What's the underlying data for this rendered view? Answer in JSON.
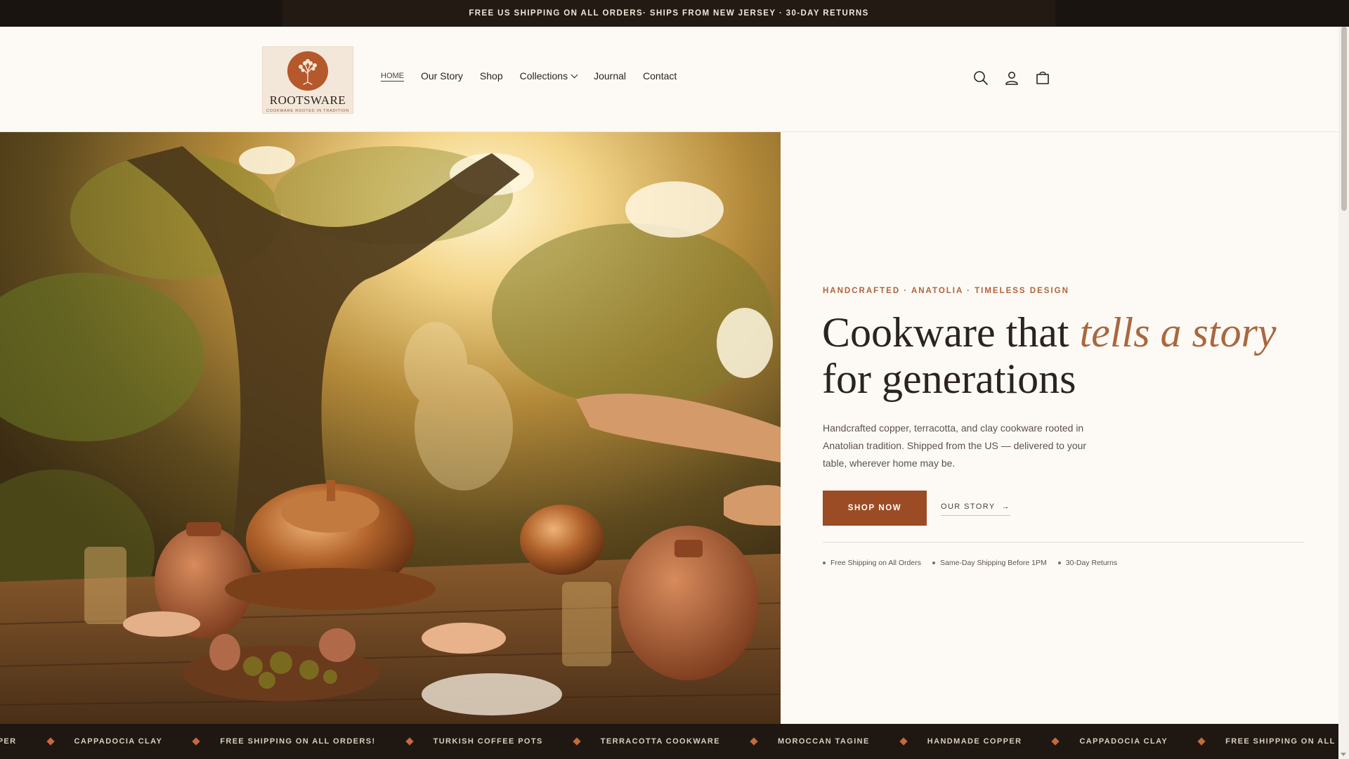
{
  "announcement": {
    "text": "FREE US SHIPPING ON ALL ORDERS· SHIPS FROM NEW JERSEY · 30-DAY RETURNS"
  },
  "brand": {
    "name": "ROOTSWARE",
    "tagline": "COOKWARE ROOTED IN TRADITION"
  },
  "nav": {
    "items": [
      {
        "label": "HOME",
        "active": true
      },
      {
        "label": "Our Story"
      },
      {
        "label": "Shop"
      },
      {
        "label": "Collections",
        "has_dropdown": true
      },
      {
        "label": "Journal"
      },
      {
        "label": "Contact"
      }
    ]
  },
  "header_icons": [
    "search-icon",
    "account-icon",
    "cart-icon"
  ],
  "hero": {
    "eyebrow": "HANDCRAFTED · ANATOLIA · TIMELESS DESIGN",
    "headline_part1": "Cookware that ",
    "headline_emphasis": "tells a story",
    "headline_part2": "for generations",
    "description": "Handcrafted copper, terracotta, and clay cookware rooted in Anatolian tradition. Shipped from the US — delivered to your table, wherever home may be.",
    "primary_cta": "SHOP NOW",
    "secondary_cta": "OUR STORY",
    "secondary_arrow": "→",
    "perks": [
      "Free Shipping on All Orders",
      "Same-Day Shipping Before 1PM",
      "30-Day Returns"
    ]
  },
  "ticker": {
    "items": [
      "OPPER",
      "CAPPADOCIA CLAY",
      "FREE SHIPPING ON ALL ORDERS!",
      "TURKISH COFFEE POTS",
      "TERRACOTTA COOKWARE",
      "MOROCCAN TAGINE",
      "HANDMADE COPPER",
      "CAPPADOCIA CLAY",
      "FREE SHIPPING ON ALL O"
    ]
  },
  "colors": {
    "accent": "#9c4c25",
    "eyebrow": "#b0633a",
    "emphasis": "#a9683f",
    "background": "#fdfaf5",
    "dark_bar": "#1f1812"
  }
}
